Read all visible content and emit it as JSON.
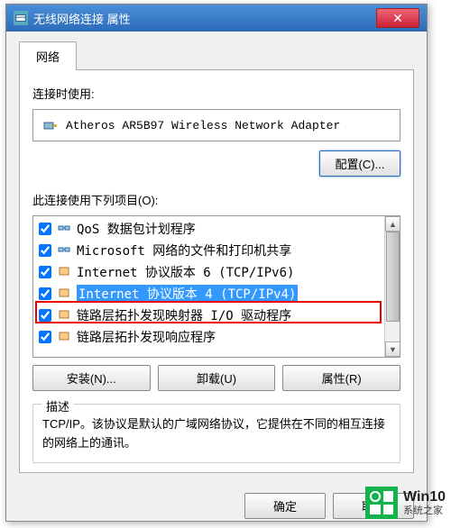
{
  "window": {
    "title": "无线网络连接 属性"
  },
  "tab": {
    "network": "网络"
  },
  "section": {
    "connect_using": "连接时使用:",
    "items_label": "此连接使用下列项目(O):"
  },
  "adapter": {
    "name": "Atheros AR5B97 Wireless Network Adapter"
  },
  "buttons": {
    "configure": "配置(C)...",
    "install": "安装(N)...",
    "uninstall": "卸载(U)",
    "properties": "属性(R)",
    "ok": "确定",
    "cancel": "取消"
  },
  "items": [
    {
      "checked": true,
      "icon": "net",
      "label": "QoS 数据包计划程序"
    },
    {
      "checked": true,
      "icon": "net",
      "label": "Microsoft 网络的文件和打印机共享"
    },
    {
      "checked": true,
      "icon": "proto",
      "label": "Internet 协议版本 6 (TCP/IPv6)"
    },
    {
      "checked": true,
      "icon": "proto",
      "label": "Internet 协议版本 4 (TCP/IPv4)",
      "selected": true
    },
    {
      "checked": true,
      "icon": "proto",
      "label": "链路层拓扑发现映射器 I/O 驱动程序"
    },
    {
      "checked": true,
      "icon": "proto",
      "label": "链路层拓扑发现响应程序"
    }
  ],
  "description": {
    "legend": "描述",
    "text": "TCP/IP。该协议是默认的广域网络协议，它提供在不同的相互连接的网络上的通讯。"
  },
  "watermark": {
    "line1": "Win10",
    "line2": "系统之家"
  }
}
